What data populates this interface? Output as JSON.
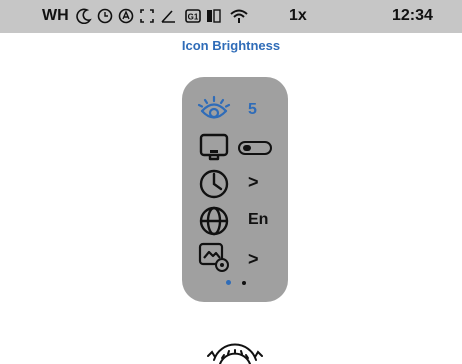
{
  "status_bar": {
    "mode": "WH",
    "zoom": "1x",
    "time": "12:34",
    "icons": [
      "night-mode-icon",
      "timer-icon",
      "auto-icon",
      "focus-frame-icon",
      "angle-icon",
      "g1-icon",
      "battery-icon",
      "wifi-icon"
    ]
  },
  "page": {
    "title": "Icon Brightness"
  },
  "menu": {
    "brightness": {
      "icon": "eye-brightness-icon",
      "value": "5"
    },
    "display": {
      "icon": "monitor-icon",
      "toggle": "off"
    },
    "clock": {
      "icon": "clock-icon",
      "chevron": ">"
    },
    "language": {
      "icon": "globe-icon",
      "value": "En"
    },
    "settings": {
      "icon": "settings-image-icon",
      "chevron": ">"
    }
  },
  "pager": {
    "current": 1,
    "total": 2
  },
  "dial": {
    "icon": "rotary-dial-icon"
  },
  "colors": {
    "accent": "#2f6cb8",
    "panel": "#a0a0a0",
    "status_bar": "#c6c6c6"
  }
}
